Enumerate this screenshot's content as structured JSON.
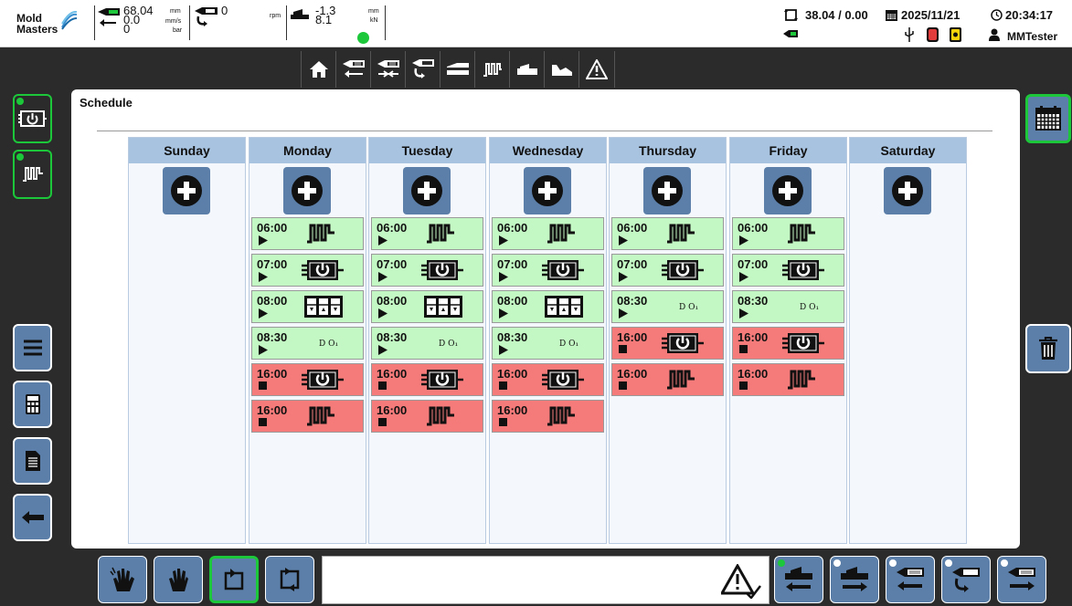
{
  "topbar": {
    "logo_line1": "Mold",
    "logo_line2": "Masters",
    "pos_value": "68.04",
    "pos_unit": "mm",
    "speed_value": "0.0",
    "speed_unit": "mm/s",
    "pressure_value": "0",
    "pressure_unit": "bar",
    "screw_value": "0",
    "rpm_unit": "rpm",
    "force_value1": "-1.3",
    "force_value2": "8.1",
    "force_unit1": "mm",
    "force_unit2": "kN",
    "cycle": "38.04 / 0.00",
    "date": "2025/11/21",
    "time": "20:34:17",
    "user": "MMTester"
  },
  "nav": {
    "items": [
      "home-icon",
      "injection-back-icon",
      "injection-nozzle-icon",
      "screw-icon",
      "mold-icon",
      "heater-icon",
      "ejector-icon",
      "graph-icon",
      "alarm-icon"
    ]
  },
  "panel": {
    "title": "Schedule"
  },
  "schedule": {
    "days": [
      {
        "name": "Sunday",
        "events": []
      },
      {
        "name": "Monday",
        "events": [
          {
            "time": "06:00",
            "action": "start",
            "icon": "heater",
            "color": "green"
          },
          {
            "time": "07:00",
            "action": "start",
            "icon": "power",
            "color": "green"
          },
          {
            "time": "08:00",
            "action": "start",
            "icon": "zones",
            "color": "green"
          },
          {
            "time": "08:30",
            "action": "start",
            "icon": "do",
            "color": "green",
            "label": "D O₁"
          },
          {
            "time": "16:00",
            "action": "stop",
            "icon": "power",
            "color": "red"
          },
          {
            "time": "16:00",
            "action": "stop",
            "icon": "heater",
            "color": "red"
          }
        ]
      },
      {
        "name": "Tuesday",
        "events": [
          {
            "time": "06:00",
            "action": "start",
            "icon": "heater",
            "color": "green"
          },
          {
            "time": "07:00",
            "action": "start",
            "icon": "power",
            "color": "green"
          },
          {
            "time": "08:00",
            "action": "start",
            "icon": "zones",
            "color": "green"
          },
          {
            "time": "08:30",
            "action": "start",
            "icon": "do",
            "color": "green",
            "label": "D O₁"
          },
          {
            "time": "16:00",
            "action": "stop",
            "icon": "power",
            "color": "red"
          },
          {
            "time": "16:00",
            "action": "stop",
            "icon": "heater",
            "color": "red"
          }
        ]
      },
      {
        "name": "Wednesday",
        "events": [
          {
            "time": "06:00",
            "action": "start",
            "icon": "heater",
            "color": "green"
          },
          {
            "time": "07:00",
            "action": "start",
            "icon": "power",
            "color": "green"
          },
          {
            "time": "08:00",
            "action": "start",
            "icon": "zones",
            "color": "green"
          },
          {
            "time": "08:30",
            "action": "start",
            "icon": "do",
            "color": "green",
            "label": "D O₁"
          },
          {
            "time": "16:00",
            "action": "stop",
            "icon": "power",
            "color": "red"
          },
          {
            "time": "16:00",
            "action": "stop",
            "icon": "heater",
            "color": "red"
          }
        ]
      },
      {
        "name": "Thursday",
        "events": [
          {
            "time": "06:00",
            "action": "start",
            "icon": "heater",
            "color": "green"
          },
          {
            "time": "07:00",
            "action": "start",
            "icon": "power",
            "color": "green"
          },
          {
            "time": "08:30",
            "action": "start",
            "icon": "do",
            "color": "green",
            "label": "D O₁"
          },
          {
            "time": "16:00",
            "action": "stop",
            "icon": "power",
            "color": "red"
          },
          {
            "time": "16:00",
            "action": "stop",
            "icon": "heater",
            "color": "red"
          }
        ]
      },
      {
        "name": "Friday",
        "events": [
          {
            "time": "06:00",
            "action": "start",
            "icon": "heater",
            "color": "green"
          },
          {
            "time": "07:00",
            "action": "start",
            "icon": "power",
            "color": "green"
          },
          {
            "time": "08:30",
            "action": "start",
            "icon": "do",
            "color": "green",
            "label": "D O₁"
          },
          {
            "time": "16:00",
            "action": "stop",
            "icon": "power",
            "color": "red"
          },
          {
            "time": "16:00",
            "action": "stop",
            "icon": "heater",
            "color": "red"
          }
        ]
      },
      {
        "name": "Saturday",
        "events": []
      }
    ]
  },
  "colors": {
    "accent": "#5b7fa8",
    "start_green": "#c3f7c3",
    "stop_red": "#f57a7a",
    "header_blue": "#a8c3e0",
    "active_green": "#1cc73a"
  }
}
